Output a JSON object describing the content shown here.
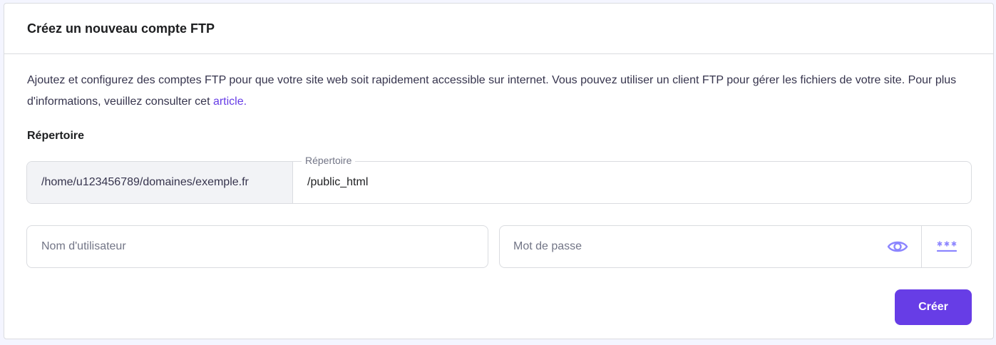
{
  "card": {
    "title": "Créez un nouveau compte FTP"
  },
  "description": {
    "text": "Ajoutez et configurez des comptes FTP pour que votre site web soit rapidement accessible sur internet. Vous pouvez utiliser un client FTP pour gérer les fichiers de votre site. Pour plus d'informations, veuillez consulter cet ",
    "link_label": "article."
  },
  "directory": {
    "section_label": "Répertoire",
    "prefix": "/home/u123456789/domaines/exemple.fr",
    "field_label": "Répertoire",
    "value": "/public_html"
  },
  "username": {
    "placeholder": "Nom d'utilisateur"
  },
  "password": {
    "placeholder": "Mot de passe",
    "show_icon": "eye-icon",
    "generate_icon": "password-generate-icon"
  },
  "actions": {
    "create_label": "Créer"
  },
  "colors": {
    "accent": "#673de6",
    "icon": "#8c85ff",
    "border": "#dadce0",
    "prefix_bg": "#f2f3f6",
    "page_bg": "#f4f5ff"
  }
}
